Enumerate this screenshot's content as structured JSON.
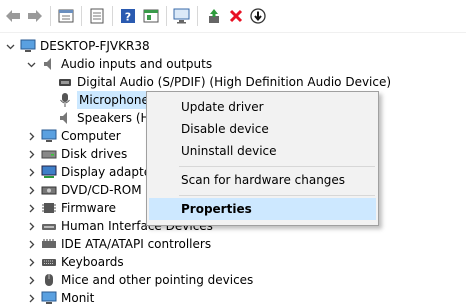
{
  "toolbar": {
    "buttons": [
      {
        "name": "back-arrow-icon"
      },
      {
        "name": "forward-arrow-icon"
      },
      {
        "name": "properties-window-icon"
      },
      {
        "name": "update-driver-pane-icon"
      },
      {
        "name": "help-icon"
      },
      {
        "name": "show-hidden-icon"
      },
      {
        "name": "monitor-scan-icon"
      },
      {
        "name": "update-driver-icon"
      },
      {
        "name": "uninstall-x-icon"
      },
      {
        "name": "disable-down-arrow-icon"
      }
    ]
  },
  "tree": {
    "root": "DESKTOP-FJVKR38",
    "audio_category": "Audio inputs and outputs",
    "audio_children": [
      "Digital Audio (S/PDIF) (High Definition Audio Device)",
      "Microphone",
      "Speakers (H"
    ],
    "categories": [
      "Computer",
      "Disk drives",
      "Display adapter",
      "DVD/CD-ROM d",
      "Firmware",
      "Human Interface Devices",
      "IDE ATA/ATAPI controllers",
      "Keyboards",
      "Mice and other pointing devices",
      "Monit"
    ]
  },
  "context_menu": {
    "update_driver": "Update driver",
    "disable_device": "Disable device",
    "uninstall_device": "Uninstall device",
    "scan_hardware": "Scan for hardware changes",
    "properties": "Properties"
  },
  "colors": {
    "selection": "#cce8ff",
    "menu_bg": "#f2f2f2",
    "menu_highlight": "#cde8ff",
    "red_x": "#e81123",
    "green": "#2e9b3c"
  }
}
